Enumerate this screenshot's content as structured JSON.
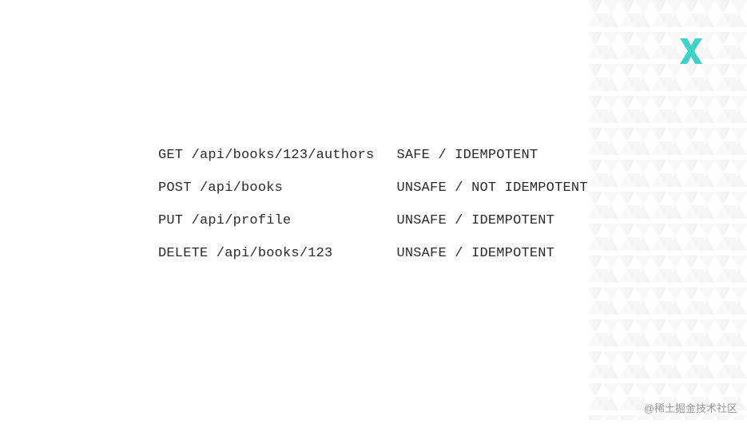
{
  "rows": [
    {
      "left": "GET /api/books/123/authors",
      "right": "SAFE / IDEMPOTENT"
    },
    {
      "left": "POST /api/books",
      "right": "UNSAFE / NOT IDEMPOTENT"
    },
    {
      "left": "PUT /api/profile",
      "right": "UNSAFE / IDEMPOTENT"
    },
    {
      "left": "DELETE /api/books/123",
      "right": "UNSAFE / IDEMPOTENT"
    }
  ],
  "watermark": "@稀土掘金技术社区",
  "logo_color": "#3fd2c7"
}
